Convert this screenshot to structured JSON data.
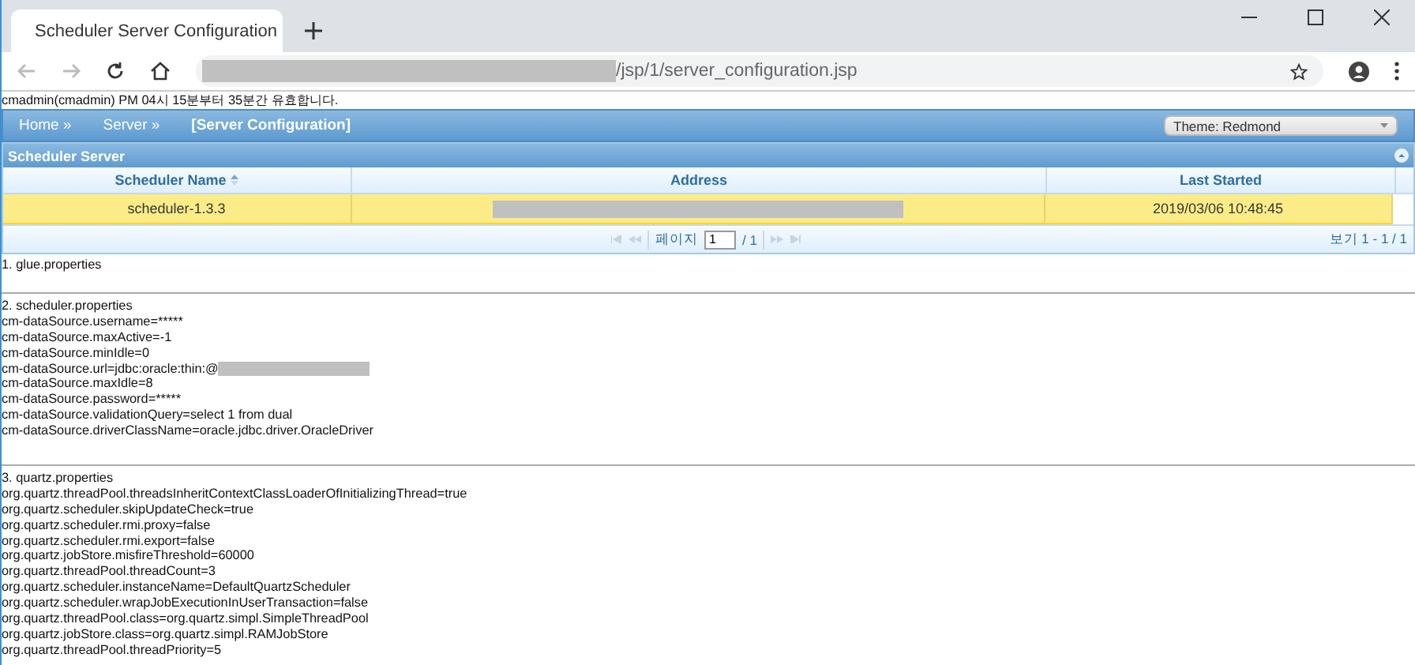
{
  "browser": {
    "tab_title": "Scheduler Server Configuration",
    "url_suffix": "/jsp/1/server_configuration.jsp"
  },
  "notice": "cmadmin(cmadmin) PM 04시 15분부터 35분간 유효합니다.",
  "nav": {
    "items": [
      {
        "label": "Home »",
        "current": false
      },
      {
        "label": "Server »",
        "current": false
      },
      {
        "label": "[Server Configuration]",
        "current": true
      }
    ],
    "theme": "Theme: Redmond"
  },
  "grid": {
    "title": "Scheduler Server",
    "columns": [
      {
        "label": "Scheduler Name",
        "sorted": true
      },
      {
        "label": "Address",
        "sorted": false
      },
      {
        "label": "Last Started",
        "sorted": false
      }
    ],
    "rows": [
      {
        "selected": true,
        "cells": [
          {
            "kind": "text",
            "text": "scheduler-1.3.3"
          },
          {
            "kind": "redacted"
          },
          {
            "kind": "text",
            "text": "2019/03/06 10:48:45"
          }
        ]
      }
    ],
    "pager": {
      "page_label": "페이지",
      "page_value": "1",
      "page_total": "/ 1",
      "view_info": "보기 1 - 1 / 1"
    }
  },
  "sections": [
    {
      "title": "1. glue.properties"
    },
    {
      "title": "2. scheduler.properties",
      "lines": [
        {
          "kind": "plain",
          "text": "cm-dataSource.username=*****"
        },
        {
          "kind": "plain",
          "text": "cm-dataSource.maxActive=-1"
        },
        {
          "kind": "plain",
          "text": "cm-dataSource.minIdle=0"
        },
        {
          "kind": "masked",
          "text": "cm-dataSource.url=jdbc:oracle:thin:@"
        },
        {
          "kind": "plain",
          "text": "cm-dataSource.maxIdle=8"
        },
        {
          "kind": "plain",
          "text": "cm-dataSource.password=*****"
        },
        {
          "kind": "plain",
          "text": "cm-dataSource.validationQuery=select 1 from dual"
        },
        {
          "kind": "plain",
          "text": "cm-dataSource.driverClassName=oracle.jdbc.driver.OracleDriver"
        }
      ]
    },
    {
      "title": "3. quartz.properties",
      "lines": [
        {
          "kind": "plain",
          "text": "org.quartz.threadPool.threadsInheritContextClassLoaderOfInitializingThread=true"
        },
        {
          "kind": "plain",
          "text": "org.quartz.scheduler.skipUpdateCheck=true"
        },
        {
          "kind": "plain",
          "text": "org.quartz.scheduler.rmi.proxy=false"
        },
        {
          "kind": "plain",
          "text": "org.quartz.scheduler.rmi.export=false"
        },
        {
          "kind": "plain",
          "text": "org.quartz.jobStore.misfireThreshold=60000"
        },
        {
          "kind": "plain",
          "text": "org.quartz.threadPool.threadCount=3"
        },
        {
          "kind": "plain",
          "text": "org.quartz.scheduler.instanceName=DefaultQuartzScheduler"
        },
        {
          "kind": "plain",
          "text": "org.quartz.scheduler.wrapJobExecutionInUserTransaction=false"
        },
        {
          "kind": "plain",
          "text": "org.quartz.threadPool.class=org.quartz.simpl.SimpleThreadPool"
        },
        {
          "kind": "plain",
          "text": "org.quartz.jobStore.class=org.quartz.simpl.RAMJobStore"
        },
        {
          "kind": "plain",
          "text": "org.quartz.threadPool.threadPriority=5"
        }
      ]
    }
  ]
}
